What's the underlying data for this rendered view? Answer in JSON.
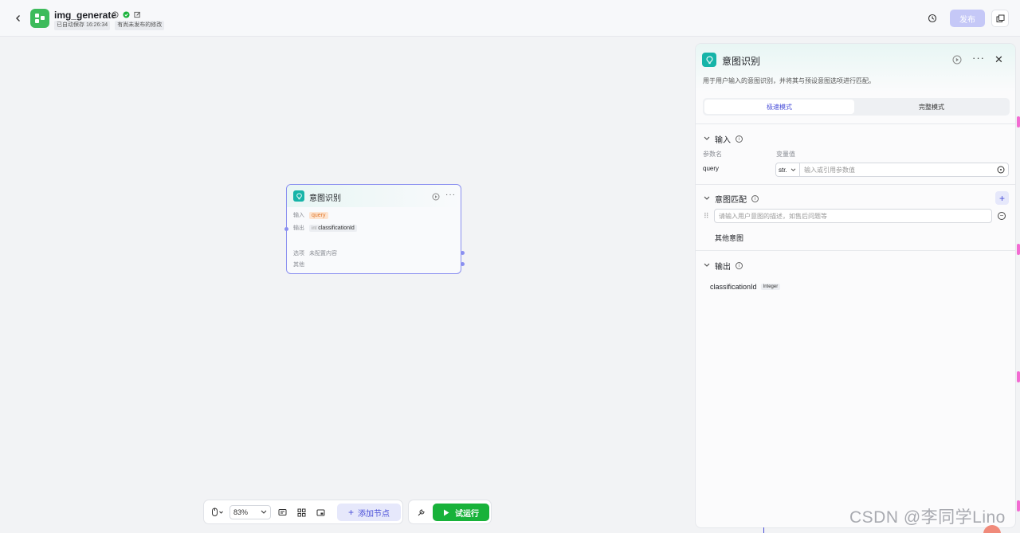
{
  "header": {
    "app_title": "img_generate",
    "autosave_text": "已自动保存 16:26:34",
    "unpublished_text": "有尚未发布的修改",
    "publish_label": "发布"
  },
  "node": {
    "title": "意图识别",
    "input_label": "输入",
    "input_value": "query",
    "output_label": "输出",
    "output_type_short": "int",
    "output_value": "classificationId",
    "options_label": "选项",
    "options_value": "未配置内容",
    "other_label": "其他"
  },
  "toolbar": {
    "zoom": "83%",
    "add_node_label": "添加节点",
    "run_label": "试运行"
  },
  "panel": {
    "title": "意图识别",
    "description": "用于用户输入的意图识别，并将其与预设意图选项进行匹配。",
    "mode_tabs": [
      {
        "label": "极速模式",
        "active": true
      },
      {
        "label": "完整模式",
        "active": false
      }
    ],
    "input_section": {
      "title": "输入",
      "param_header": "参数名",
      "value_header": "变量值",
      "param_name": "query",
      "type_select": "str.",
      "value_placeholder": "输入或引用参数值"
    },
    "intent_section": {
      "title": "意图匹配",
      "intent_placeholder": "请输入用户意图的描述，如售后问题等",
      "other_intent": "其他意图"
    },
    "output_section": {
      "title": "输出",
      "output_name": "classificationId",
      "output_type": "Integer"
    }
  },
  "watermark": "CSDN @李同学Lino"
}
